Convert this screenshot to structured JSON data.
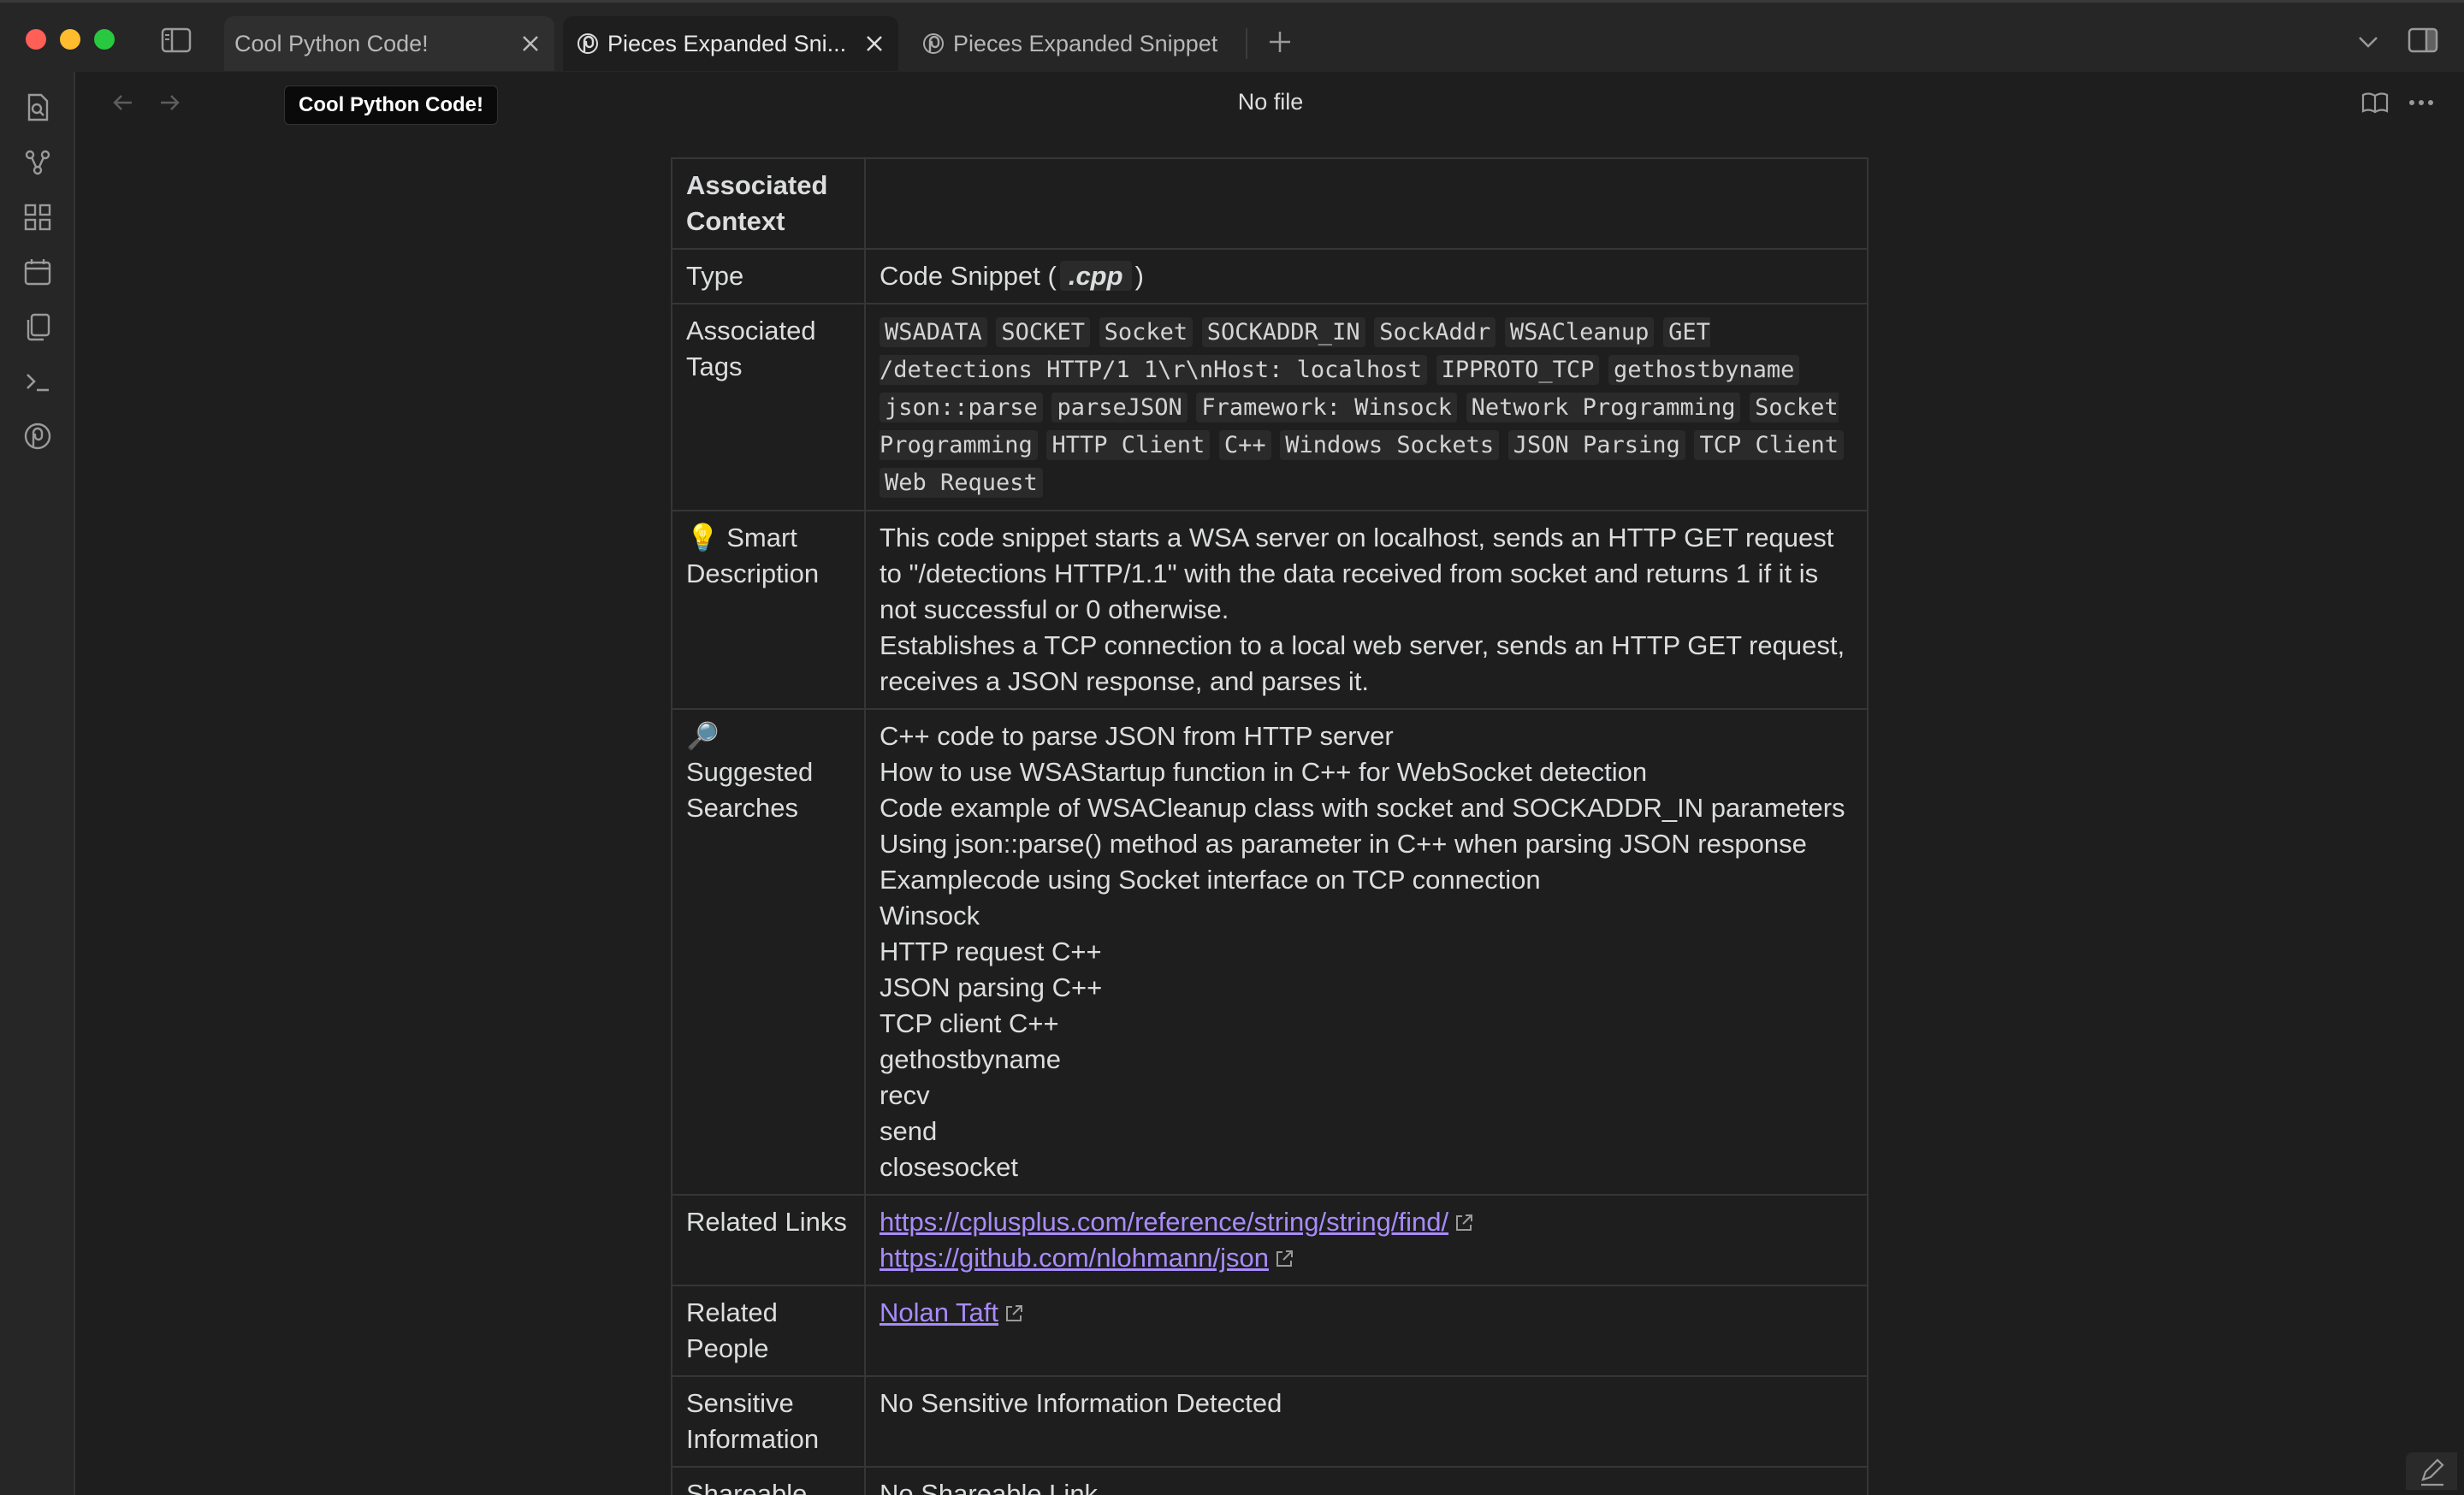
{
  "tabs": [
    {
      "label": "Cool Python Code!",
      "active": false
    },
    {
      "label": "Pieces Expanded Sni...",
      "active": true
    },
    {
      "label": "Pieces Expanded Snippet",
      "active": false
    }
  ],
  "tooltip": "Cool Python Code!",
  "view": {
    "title": "No file"
  },
  "table": {
    "associated_context": {
      "key": "Associated Context",
      "value": ""
    },
    "type": {
      "key": "Type",
      "value_prefix": "Code Snippet",
      "ext": ".cpp"
    },
    "tags": {
      "key": "Associated Tags",
      "items": [
        "WSADATA",
        "SOCKET",
        "Socket",
        "SOCKADDR_IN",
        "SockAddr",
        "WSACleanup",
        "GET /detections HTTP/1 1\\r\\nHost: localhost",
        "IPPROTO_TCP",
        "gethostbyname",
        "json::parse",
        "parseJSON",
        "Framework: Winsock",
        "Network Programming",
        "Socket Programming",
        "HTTP Client",
        "C++",
        "Windows Sockets",
        "JSON Parsing",
        "TCP Client",
        "Web Request"
      ]
    },
    "description": {
      "icon": "💡",
      "key": "Smart Description",
      "lines": [
        "This code snippet starts a WSA server on localhost, sends an HTTP GET request to \"/detections HTTP/1.1\" with the data received from socket and returns 1 if it is not successful or 0 otherwise.",
        "Establishes a TCP connection to a local web server, sends an HTTP GET request, receives a JSON response, and parses it."
      ]
    },
    "searches": {
      "icon": "🔎",
      "key": "Suggested Searches",
      "items": [
        "C++ code to parse JSON from HTTP server",
        "How to use WSAStartup function in C++ for WebSocket detection",
        "Code example of WSACleanup class with socket and SOCKADDR_IN parameters",
        "Using json::parse() method as parameter in C++ when parsing JSON response",
        "Examplecode using Socket interface on TCP connection",
        "Winsock",
        "HTTP request C++",
        "JSON parsing C++",
        "TCP client C++",
        "gethostbyname",
        "recv",
        "send",
        "closesocket"
      ]
    },
    "links": {
      "key": "Related Links",
      "items": [
        "https://cplusplus.com/reference/string/string/find/",
        "https://github.com/nlohmann/json"
      ]
    },
    "people": {
      "key": "Related People",
      "items": [
        "Nolan Taft"
      ]
    },
    "sensitive": {
      "key": "Sensitive Information",
      "value": "No Sensitive Information Detected"
    },
    "shareable": {
      "key": "Shareable",
      "value": "No Shareable Link"
    }
  },
  "icons": {
    "ribbon": [
      "file-search-icon",
      "graph-icon",
      "grid-icon",
      "calendar-icon",
      "copy-icon",
      "terminal-icon",
      "pieces-icon"
    ]
  },
  "colors": {
    "link": "#a88bfa",
    "background": "#1e1e1e"
  }
}
